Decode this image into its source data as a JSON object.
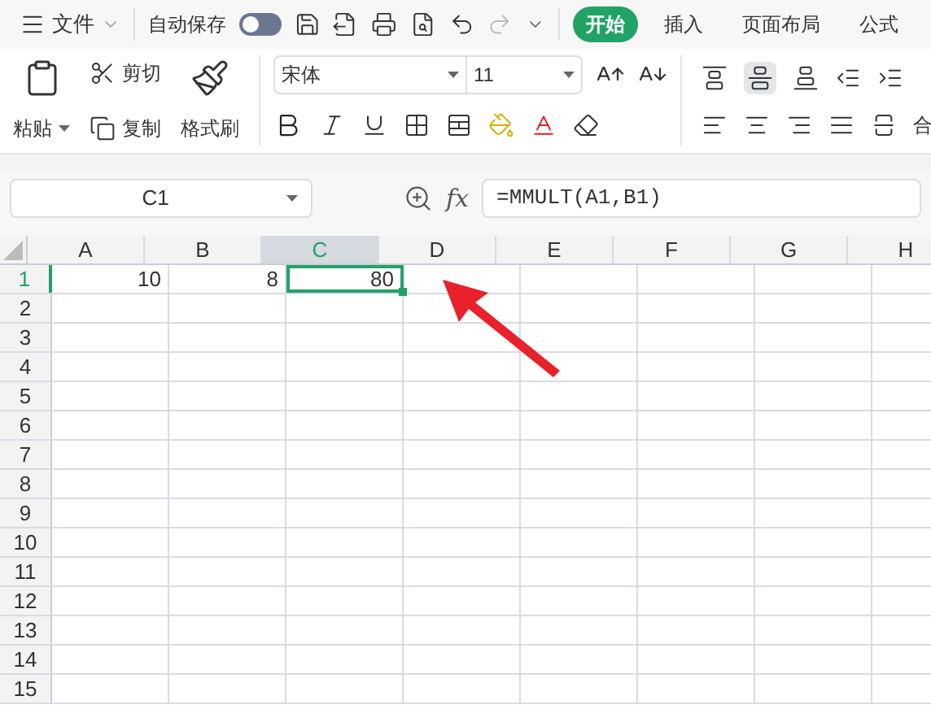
{
  "menu": {
    "label": "文件"
  },
  "autosave": {
    "label": "自动保存",
    "on": false
  },
  "tabs": [
    {
      "label": "开始",
      "selected": true
    },
    {
      "label": "插入",
      "selected": false
    },
    {
      "label": "页面布局",
      "selected": false
    },
    {
      "label": "公式",
      "selected": false
    }
  ],
  "clipboard": {
    "paste": "粘贴",
    "cut": "剪切",
    "copy": "复制",
    "format_painter": "格式刷"
  },
  "font": {
    "name": "宋体",
    "size": "11"
  },
  "merge_label": "合",
  "name_box": "C1",
  "fx_label": "fx",
  "formula": "=MMULT(A1,B1)",
  "columns": [
    {
      "label": "A",
      "selected": false
    },
    {
      "label": "B",
      "selected": false
    },
    {
      "label": "C",
      "selected": true
    },
    {
      "label": "D",
      "selected": false
    },
    {
      "label": "E",
      "selected": false
    },
    {
      "label": "F",
      "selected": false
    },
    {
      "label": "G",
      "selected": false
    },
    {
      "label": "H",
      "selected": false
    }
  ],
  "rows": [
    {
      "label": "1",
      "selected": true,
      "cells": [
        {
          "value": "10",
          "selected": false
        },
        {
          "value": "8",
          "selected": false
        },
        {
          "value": "80",
          "selected": true
        }
      ]
    },
    {
      "label": "2",
      "selected": false
    },
    {
      "label": "3",
      "selected": false
    },
    {
      "label": "4",
      "selected": false
    },
    {
      "label": "5",
      "selected": false
    },
    {
      "label": "6",
      "selected": false
    },
    {
      "label": "7",
      "selected": false
    },
    {
      "label": "8",
      "selected": false
    },
    {
      "label": "9",
      "selected": false
    },
    {
      "label": "10",
      "selected": false
    },
    {
      "label": "11",
      "selected": false
    },
    {
      "label": "12",
      "selected": false
    },
    {
      "label": "13",
      "selected": false
    },
    {
      "label": "14",
      "selected": false
    },
    {
      "label": "15",
      "selected": false
    }
  ]
}
